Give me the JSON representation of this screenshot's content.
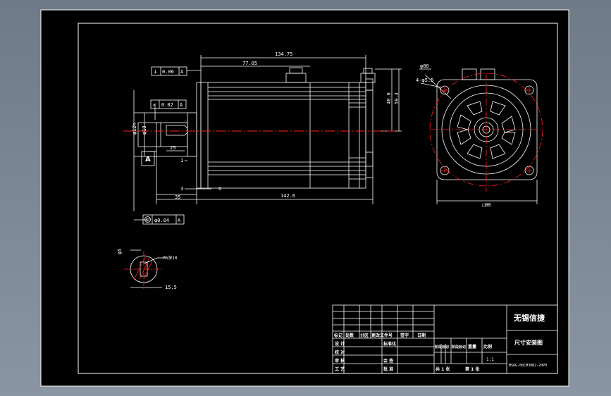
{
  "colors": {
    "background": "#7d8794",
    "sheet": "#000000",
    "line": "#ffffff",
    "centerline": "#ff2020"
  },
  "side_view": {
    "total_length": "134.75",
    "body_length": "77.05",
    "overall_length": "142.6",
    "flange_height": "40.8",
    "frame_height": "59.3",
    "shaft_diameter_a": "φ12h",
    "shaft_diameter_b": "φ19",
    "key_length": "25",
    "shaft_length": "35",
    "flange_thickness": "3",
    "pilot_length": "6",
    "gap_1": "1",
    "datum": "A",
    "tol_perpendicular_value": "0.06",
    "tol_perpendicular_datum": "A",
    "tol_runout_value": "0.02",
    "tol_runout_datum": "A",
    "tol_concentric_value": "φ0.04",
    "tol_concentric_datum": "A"
  },
  "front_view": {
    "pcd": "φ80",
    "holes": "4-φ5.5",
    "width": "□80"
  },
  "section_view": {
    "diameter": "φ5",
    "thread": "M6深10",
    "depth": "15.5"
  },
  "title_block": {
    "company": "无锡信捷",
    "drawing_name": "尺寸安装图",
    "drawing_number": "MS6G-80CM30B2-20P0",
    "scale": "1:1",
    "total_sheets": "共 1 张",
    "sheet_no": "第 1 张",
    "cols": [
      "标记",
      "处数",
      "分区",
      "更改文件号",
      "签字",
      "日期"
    ],
    "rows": [
      "设 计",
      "校 对",
      "审 核",
      "工 艺"
    ],
    "standardization": "标准化",
    "approve": "会 签",
    "approve2": "批 准",
    "stage_labels": [
      "阶段标记",
      "阶段标记",
      "重量",
      "比例"
    ]
  }
}
